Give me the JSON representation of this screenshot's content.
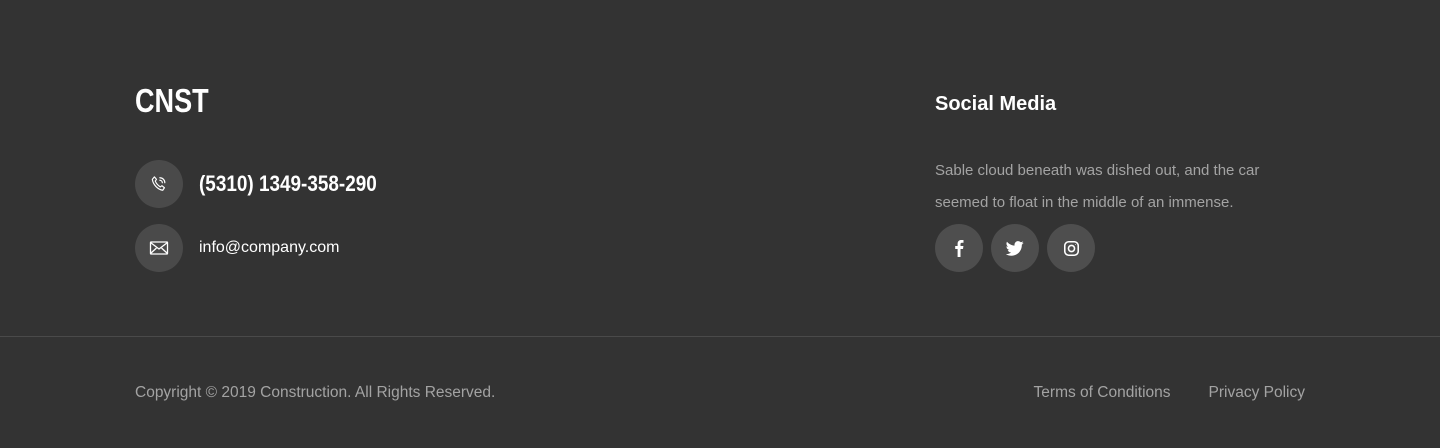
{
  "brand": {
    "logo_text": "CNST"
  },
  "contact": {
    "phone": "(5310) 1349-358-290",
    "email": "info@company.com",
    "phone_icon": "phone-icon",
    "email_icon": "mail-icon"
  },
  "social": {
    "title": "Social Media",
    "description": "Sable cloud beneath was dished out, and the car seemed to float in the middle of an immense.",
    "icons": [
      "facebook-icon",
      "twitter-icon",
      "instagram-icon"
    ]
  },
  "footer_bottom": {
    "copyright": "Copyright © 2019 Construction. All Rights Reserved.",
    "links": [
      {
        "label": "Terms of Conditions"
      },
      {
        "label": "Privacy Policy"
      }
    ]
  },
  "colors": {
    "background": "#333333",
    "icon_circle": "#4a4a4a",
    "muted_text": "#a3a3a3",
    "divider": "#4a4a4a"
  }
}
